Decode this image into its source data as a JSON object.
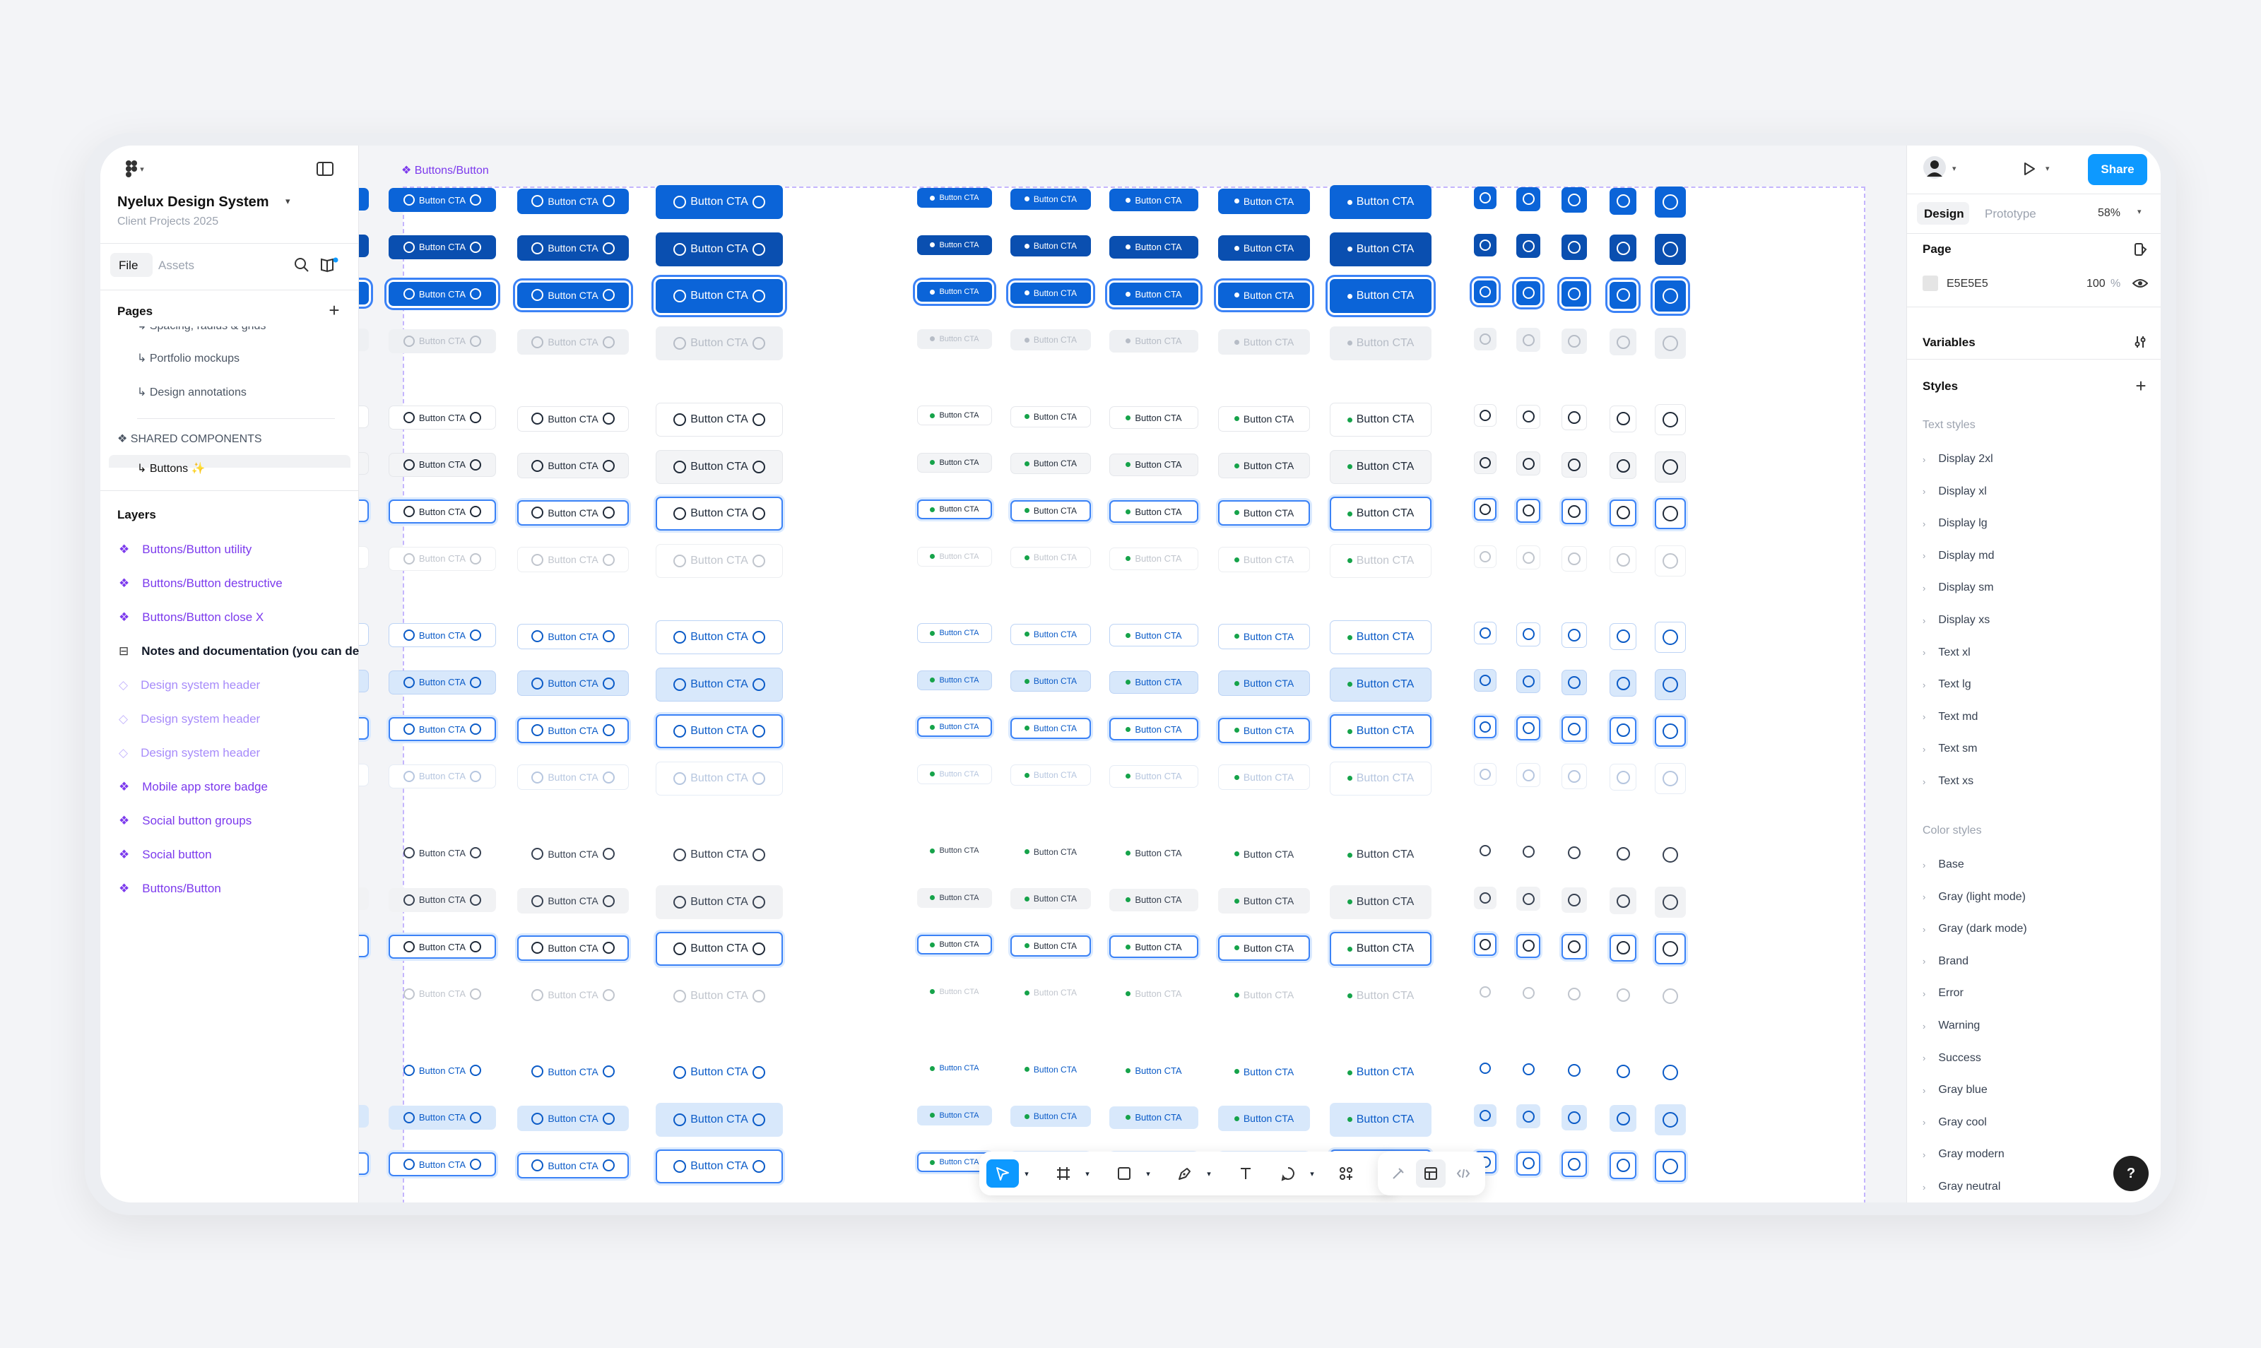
{
  "project": {
    "name": "Nyelux Design System",
    "team": "Client Projects 2025"
  },
  "left_tabs": {
    "file": "File",
    "assets": "Assets"
  },
  "pages": {
    "heading": "Pages",
    "items": [
      "↳ Spacing, radius & grids",
      "↳ Portfolio mockups",
      "↳ Design annotations"
    ],
    "section_label": "SHARED COMPONENTS",
    "selected": "↳ Buttons ✨"
  },
  "layers": {
    "heading": "Layers",
    "items": [
      "Buttons/Button utility",
      "Buttons/Button destructive",
      "Buttons/Button close X",
      "Notes and documentation (you can delete)",
      "Design system header",
      "Design system header",
      "Design system header",
      "Mobile app store badge",
      "Social button groups",
      "Social button",
      "Buttons/Button"
    ]
  },
  "canvas": {
    "frame_label": "Buttons/Button",
    "button_label": "Button CTA"
  },
  "right": {
    "tabs": {
      "design": "Design",
      "prototype": "Prototype"
    },
    "zoom": "58%",
    "share_label": "Share",
    "page_section": "Page",
    "page_color": "E5E5E5",
    "page_opacity": "100",
    "percent": "%",
    "variables": "Variables",
    "styles": "Styles",
    "text_styles_label": "Text styles",
    "text_styles": [
      "Display 2xl",
      "Display xl",
      "Display lg",
      "Display md",
      "Display sm",
      "Display xs",
      "Text xl",
      "Text lg",
      "Text md",
      "Text sm",
      "Text xs"
    ],
    "color_styles_label": "Color styles",
    "color_styles": [
      "Base",
      "Gray (light mode)",
      "Gray (dark mode)",
      "Brand",
      "Error",
      "Warning",
      "Success",
      "Gray blue",
      "Gray cool",
      "Gray modern",
      "Gray neutral"
    ]
  },
  "colors": {
    "accent": "#0d99ff",
    "brand": "#0b64d8",
    "component": "#7c3aed"
  },
  "icons": [
    "figma-logo-icon",
    "sidebar-toggle-icon",
    "search-icon",
    "library-icon",
    "plus-icon",
    "component-icon",
    "play-icon",
    "eye-icon",
    "adjust-icon",
    "move-tool-icon",
    "frame-tool-icon",
    "rectangle-tool-icon",
    "pen-tool-icon",
    "text-tool-icon",
    "comment-tool-icon",
    "actions-icon",
    "draw-mode-icon",
    "design-mode-icon",
    "dev-mode-icon",
    "help-icon"
  ]
}
